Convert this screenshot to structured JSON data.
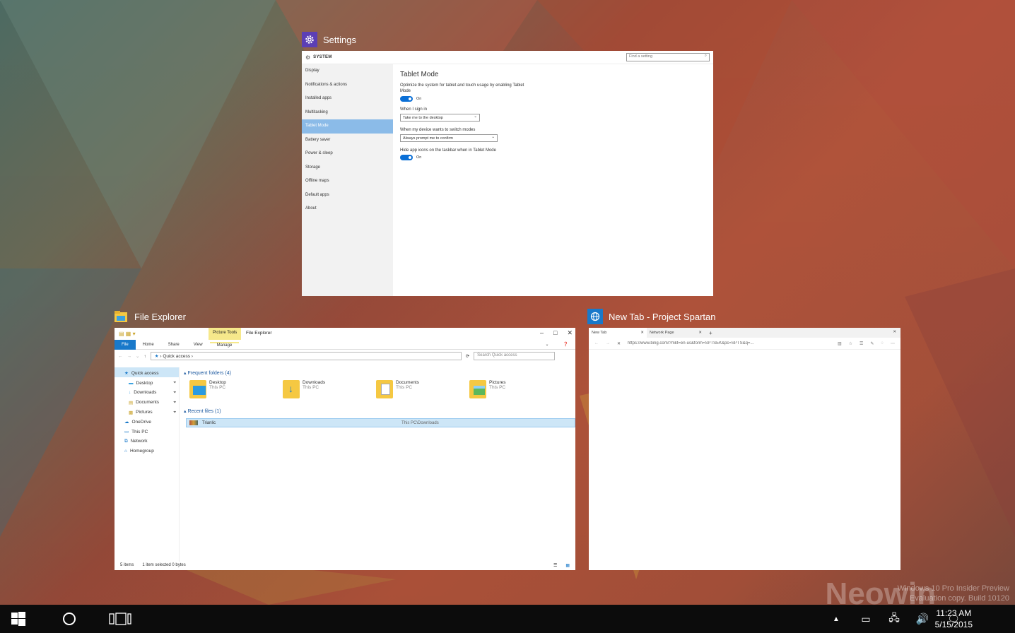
{
  "settings": {
    "title": "Settings",
    "header": "SYSTEM",
    "search_placeholder": "Find a setting",
    "nav": [
      "Display",
      "Notifications & actions",
      "Installed apps",
      "Multitasking",
      "Tablet Mode",
      "Battery saver",
      "Power & sleep",
      "Storage",
      "Offline maps",
      "Default apps",
      "About"
    ],
    "selected_nav": "Tablet Mode",
    "page_title": "Tablet Mode",
    "opt1_desc": "Optimize the system for tablet and touch usage by enabling Tablet Mode",
    "opt1_state": "On",
    "signin_label": "When I sign in",
    "signin_value": "Take me to the desktop",
    "switch_label": "When my device wants to switch modes",
    "switch_value": "Always prompt me to confirm",
    "hide_label": "Hide app icons on the taskbar when in Tablet Mode",
    "hide_state": "On"
  },
  "explorer": {
    "title": "File Explorer",
    "window_title": "File Explorer",
    "picture_tools": "Picture Tools",
    "tabs": {
      "file": "File",
      "home": "Home",
      "share": "Share",
      "view": "View",
      "manage": "Manage"
    },
    "address": "Quick access",
    "search_placeholder": "Search Quick access",
    "nav": {
      "quick": "Quick access",
      "desktop": "Desktop",
      "downloads": "Downloads",
      "documents": "Documents",
      "pictures": "Pictures",
      "onedrive": "OneDrive",
      "thispc": "This PC",
      "network": "Network",
      "homegroup": "Homegroup"
    },
    "frequent_header": "Frequent folders (4)",
    "folders": [
      {
        "name": "Desktop",
        "loc": "This PC"
      },
      {
        "name": "Downloads",
        "loc": "This PC"
      },
      {
        "name": "Documents",
        "loc": "This PC"
      },
      {
        "name": "Pictures",
        "loc": "This PC"
      }
    ],
    "recent_header": "Recent files (1)",
    "recent_file": {
      "name": "Trianlic",
      "path": "This PC\\Downloads"
    },
    "status_items": "5 items",
    "status_selected": "1 item selected  0 bytes"
  },
  "spartan": {
    "title": "New Tab - Project Spartan",
    "tab1": "New Tab",
    "tab2": "Network Page",
    "url": "https://www.bing.com/?mkt=en-us&form=SPTSEK&pc=SPTS&q=..."
  },
  "taskbar": {
    "time": "11:23 AM",
    "date": "5/15/2015"
  },
  "watermark": {
    "line1": "Windows 10 Pro Insider Preview",
    "line2": "Evaluation copy. Build 10120",
    "brand": "Neowin"
  },
  "colors": {
    "accent": "#0a6fd6",
    "settings_icon_bg": "#5b3fb5",
    "taskbar": "#0c0c0c"
  }
}
